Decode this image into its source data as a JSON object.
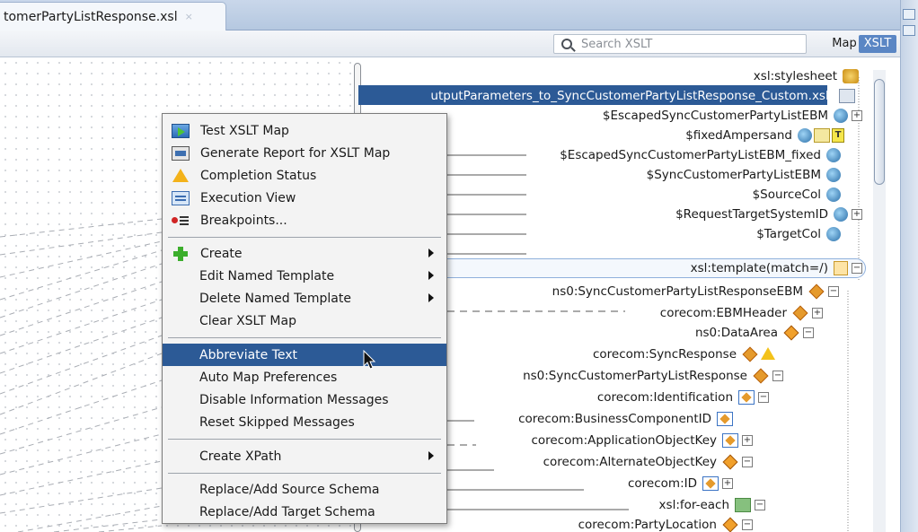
{
  "tab": {
    "title": "tomerPartyListResponse.xsl",
    "close": "×"
  },
  "toolbar": {
    "search_placeholder": "Search XSLT",
    "map_label": "Map",
    "xslt_label": "XSLT"
  },
  "tree": {
    "rows": [
      {
        "label": "xsl:stylesheet"
      },
      {
        "label": "utputParameters_to_SyncCustomerPartyListResponse_Custom.xsl)"
      },
      {
        "label": "$EscapedSyncCustomerPartyListEBM"
      },
      {
        "label": "$fixedAmpersand"
      },
      {
        "label": "$EscapedSyncCustomerPartyListEBM_fixed"
      },
      {
        "label": "$SyncCustomerPartyListEBM"
      },
      {
        "label": "$SourceCol"
      },
      {
        "label": "$RequestTargetSystemID"
      },
      {
        "label": "$TargetCol"
      },
      {
        "label": "xsl:template(match=/)"
      },
      {
        "label": "ns0:SyncCustomerPartyListResponseEBM"
      },
      {
        "label": "corecom:EBMHeader"
      },
      {
        "label": "ns0:DataArea"
      },
      {
        "label": "corecom:SyncResponse"
      },
      {
        "label": "ns0:SyncCustomerPartyListResponse"
      },
      {
        "label": "corecom:Identification"
      },
      {
        "label": "corecom:BusinessComponentID"
      },
      {
        "label": "corecom:ApplicationObjectKey"
      },
      {
        "label": "corecom:AlternateObjectKey"
      },
      {
        "label": "corecom:ID"
      },
      {
        "label": "xsl:for-each"
      },
      {
        "label": "corecom:PartyLocation"
      }
    ],
    "t_badge": "T"
  },
  "menu": {
    "items": [
      {
        "label": "Test XSLT Map",
        "icon": "play-icon"
      },
      {
        "label": "Generate Report for XSLT Map",
        "icon": "report-icon"
      },
      {
        "label": "Completion Status",
        "icon": "warning-icon"
      },
      {
        "label": "Execution View",
        "icon": "execution-view-icon"
      },
      {
        "label": "Breakpoints...",
        "icon": "breakpoints-icon"
      },
      {
        "label": "Create",
        "icon": "plus-icon",
        "submenu": true
      },
      {
        "label": "Edit Named Template",
        "submenu": true
      },
      {
        "label": "Delete Named Template",
        "submenu": true
      },
      {
        "label": "Clear XSLT Map"
      },
      {
        "label": "Abbreviate Text",
        "highlighted": true
      },
      {
        "label": "Auto Map Preferences"
      },
      {
        "label": "Disable Information Messages"
      },
      {
        "label": "Reset Skipped Messages"
      },
      {
        "label": "Create XPath",
        "submenu": true
      },
      {
        "label": "Replace/Add Source Schema"
      },
      {
        "label": "Replace/Add Target Schema"
      }
    ]
  },
  "colors": {
    "selection": "#2c5a96",
    "accent": "#5a86c4"
  }
}
